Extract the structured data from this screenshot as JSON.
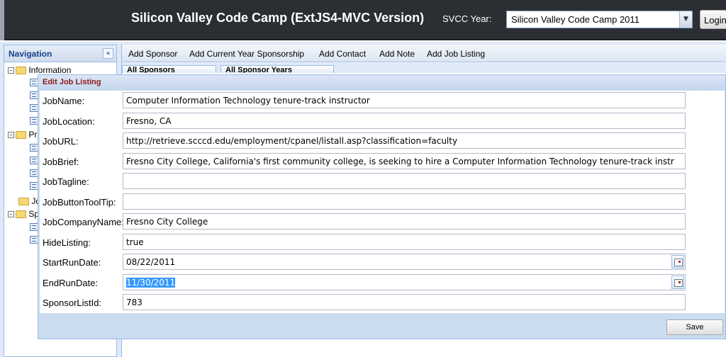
{
  "header": {
    "title": "Silicon Valley Code Camp (ExtJS4-MVC Version)",
    "year_label": "SVCC Year:",
    "year_selected": "Silicon Valley Code Camp 2011",
    "login_label": "Login"
  },
  "navigation": {
    "title": "Navigation",
    "tree": [
      {
        "label": "Information"
      },
      {
        "label": "Pr"
      },
      {
        "label": "Jo"
      },
      {
        "label": "Sp"
      }
    ]
  },
  "toolbar": {
    "items": [
      "Add Sponsor",
      "Add Current Year Sponsorship",
      "Add Contact",
      "Add Note",
      "Add Job Listing"
    ]
  },
  "tabs": [
    "All Sponsors",
    "All Sponsor Years"
  ],
  "dialog": {
    "title": "Edit Job Listing",
    "fields": [
      {
        "label": "JobName:",
        "value": "Computer Information Technology tenure-track instructor"
      },
      {
        "label": "JobLocation:",
        "value": "Fresno, CA"
      },
      {
        "label": "JobURL:",
        "value": "http://retrieve.scccd.edu/employment/cpanel/listall.asp?classification=faculty"
      },
      {
        "label": "JobBrief:",
        "value": "Fresno City College, California's first community college, is seeking to hire a Computer Information Technology tenure-track instr"
      },
      {
        "label": "JobTagline:",
        "value": ""
      },
      {
        "label": "JobButtonToolTip:",
        "value": ""
      },
      {
        "label": "JobCompanyName:",
        "value": "Fresno City College"
      },
      {
        "label": "HideListing:",
        "value": "true"
      },
      {
        "label": "StartRunDate:",
        "value": "08/22/2011"
      },
      {
        "label": "EndRunDate:",
        "value": "11/30/2011"
      },
      {
        "label": "SponsorListId:",
        "value": "783"
      }
    ],
    "save_label": "Save"
  },
  "colors": {
    "header_bg": "#2b2f34",
    "panel_title": "#15428b",
    "dialog_title": "#8b1a1a",
    "selection": "#3399ff"
  }
}
